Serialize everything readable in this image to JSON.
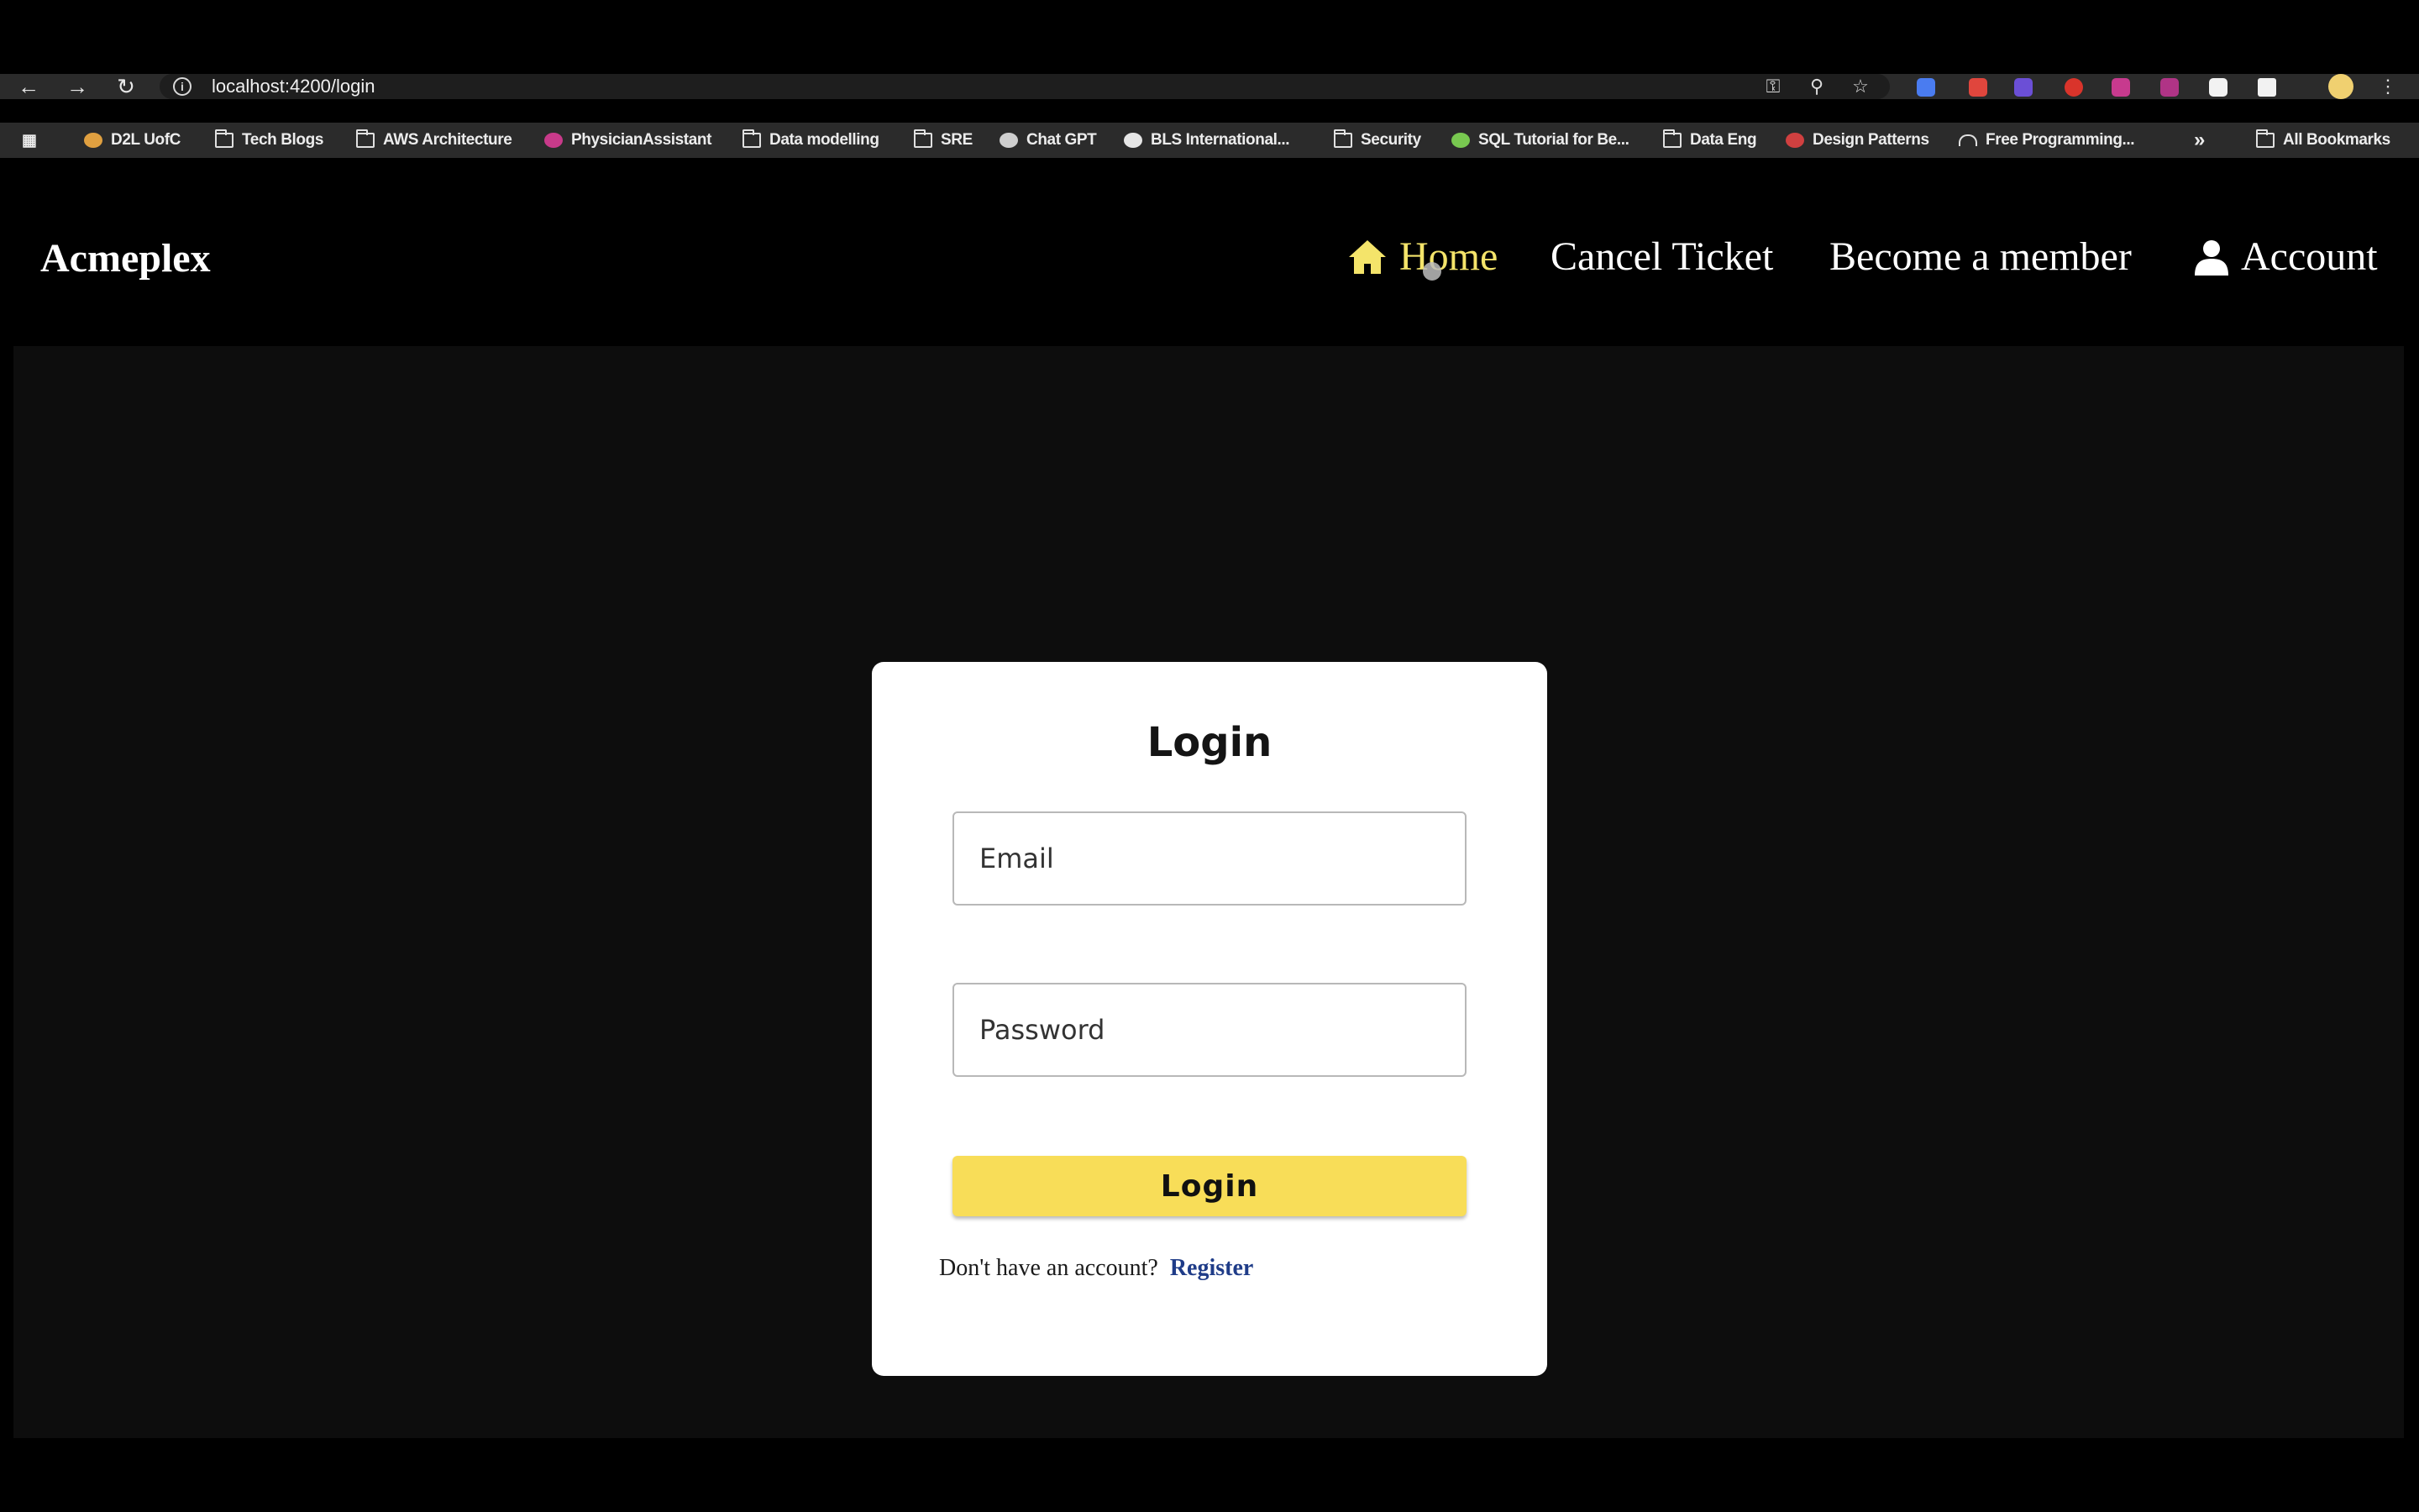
{
  "browser": {
    "url": "localhost:4200/login",
    "bookmarks": [
      {
        "label": "D2L UofC",
        "icon": "d2l-icon"
      },
      {
        "label": "Tech Blogs",
        "icon": "folder-icon"
      },
      {
        "label": "AWS Architecture",
        "icon": "folder-icon"
      },
      {
        "label": "PhysicianAssistant",
        "icon": "angular-icon"
      },
      {
        "label": "Data modelling",
        "icon": "folder-icon"
      },
      {
        "label": "SRE",
        "icon": "folder-icon"
      },
      {
        "label": "Chat GPT",
        "icon": "chatgpt-icon"
      },
      {
        "label": "BLS International...",
        "icon": "globe-icon"
      },
      {
        "label": "Security",
        "icon": "folder-icon"
      },
      {
        "label": "SQL Tutorial for Be...",
        "icon": "sql-icon"
      },
      {
        "label": "Data Eng",
        "icon": "folder-icon"
      },
      {
        "label": "Design Patterns",
        "icon": "design-patterns-icon"
      },
      {
        "label": "Free Programming...",
        "icon": "headphones-icon"
      }
    ],
    "more_label": "»",
    "all_bookmarks": "All Bookmarks"
  },
  "navbar": {
    "brand": "Acmeplex",
    "home": "Home",
    "cancel_ticket": "Cancel Ticket",
    "become_member": "Become a member",
    "account": "Account",
    "active_color": "#f4e46a"
  },
  "login": {
    "title": "Login",
    "email_placeholder": "Email",
    "password_placeholder": "Password",
    "button_label": "Login",
    "no_account_text": "Don't have an account?",
    "register_link": "Register",
    "button_color": "#f8dd58",
    "link_color": "#1f3c88"
  }
}
